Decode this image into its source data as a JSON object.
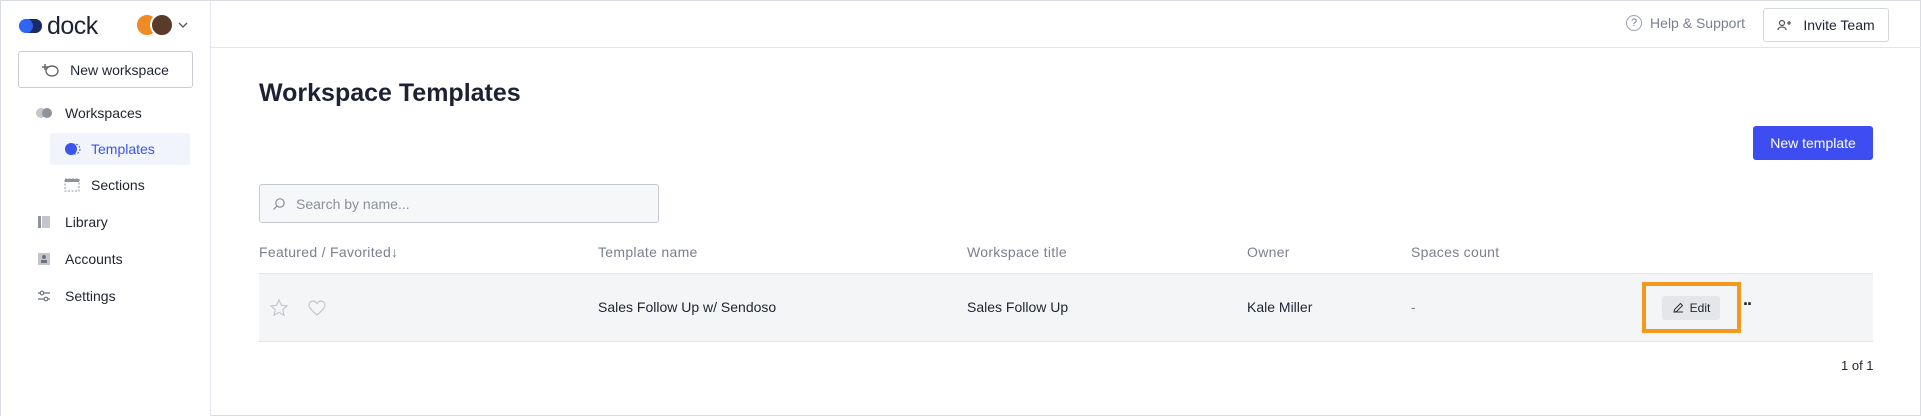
{
  "app": {
    "name": "dock"
  },
  "sidebar": {
    "new_workspace_label": "New workspace",
    "items": [
      {
        "label": "Workspaces",
        "icon": "workspaces-icon"
      },
      {
        "label": "Templates",
        "icon": "templates-icon",
        "active": true
      },
      {
        "label": "Sections",
        "icon": "sections-icon"
      },
      {
        "label": "Library",
        "icon": "library-icon"
      },
      {
        "label": "Accounts",
        "icon": "accounts-icon"
      },
      {
        "label": "Settings",
        "icon": "settings-icon"
      }
    ]
  },
  "header": {
    "help_label": "Help & Support",
    "invite_label": "Invite Team"
  },
  "main": {
    "title": "Workspace Templates",
    "new_template_label": "New template",
    "search": {
      "placeholder": "Search by name...",
      "value": ""
    },
    "table": {
      "columns": [
        "Featured / Favorited↓",
        "Template name",
        "Workspace title",
        "Owner",
        "Spaces count"
      ],
      "rows": [
        {
          "template_name": "Sales Follow Up w/ Sendoso",
          "workspace_title": "Sales Follow Up",
          "owner": "Kale Miller",
          "spaces_count": "-",
          "edit_label": "Edit"
        }
      ]
    },
    "pagination": "1 of 1"
  },
  "colors": {
    "accent": "#3d4df2",
    "active_nav_text": "#3c55f0",
    "highlight_frame": "#f39a1e"
  }
}
